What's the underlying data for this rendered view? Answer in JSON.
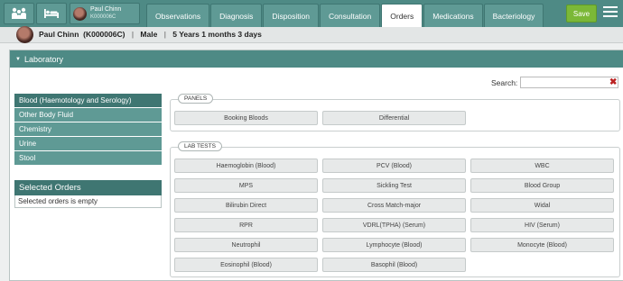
{
  "patient_chip": {
    "name": "Paul Chinn",
    "id": "K000006C"
  },
  "tabs": [
    {
      "label": "Observations"
    },
    {
      "label": "Diagnosis"
    },
    {
      "label": "Disposition"
    },
    {
      "label": "Consultation"
    },
    {
      "label": "Orders"
    },
    {
      "label": "Medications"
    },
    {
      "label": "Bacteriology"
    }
  ],
  "active_tab": "Orders",
  "toolbar": {
    "save_label": "Save"
  },
  "banner": {
    "patient": "Paul Chinn",
    "patient_id": "(K000006C)",
    "gender": "Male",
    "age": "5 Years 1 months 3 days"
  },
  "lab": {
    "title": "Laboratory",
    "search_label": "Search:",
    "categories": [
      "Blood (Haemotology and Serology)",
      "Other Body Fluid",
      "Chemistry",
      "Urine",
      "Stool"
    ],
    "selected_orders": {
      "title": "Selected Orders",
      "empty_text": "Selected orders is empty"
    },
    "panels": {
      "legend": "PANELS",
      "items": [
        "Booking Bloods",
        "Differential"
      ]
    },
    "lab_tests": {
      "legend": "LAB TESTS",
      "items": [
        "Haemoglobin (Blood)",
        "PCV (Blood)",
        "WBC",
        "MPS",
        "Sickling Test",
        "Blood Group",
        "Bilirubin Direct",
        "Cross Match-major",
        "Widal",
        "RPR",
        "VDRL(TPHA) (Serum)",
        "HIV (Serum)",
        "Neutrophil",
        "Lymphocyte (Blood)",
        "Monocyte (Blood)",
        "Eosinophil (Blood)",
        "Basophil (Blood)"
      ]
    }
  },
  "icons": {
    "family": "family-icon",
    "bed": "bed-icon",
    "menu": "hamburger-menu-icon",
    "clear": "clear-search-icon"
  },
  "colors": {
    "primary": "#4e8a85",
    "active_category": "#3f7672",
    "save": "#7bb837"
  }
}
